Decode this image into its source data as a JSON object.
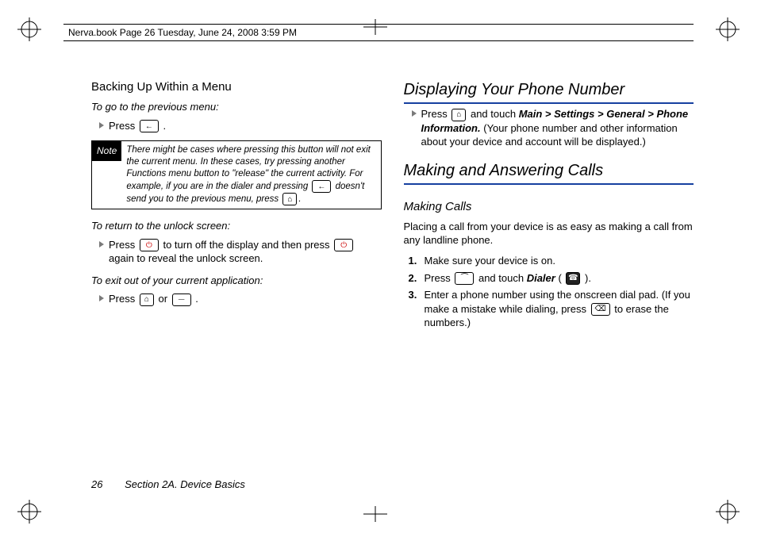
{
  "header": "Nerva.book  Page 26  Tuesday, June 24, 2008  3:59 PM",
  "left": {
    "h2": "Backing Up Within a Menu",
    "lead1": "To go to the previous menu:",
    "press": "Press ",
    "dot": ".",
    "noteLabel": "Note",
    "noteBody1": "There might be cases where pressing this button will not exit the current menu. In these cases, try pressing another Functions menu button to \"release\" the current activity. For example, if you are in the dialer and pressing ",
    "noteBody2": " doesn't send you to the previous menu, press ",
    "lead2": "To return to the unlock screen:",
    "unlock1": " to turn off the display and then press ",
    "unlock2": " again to reveal the unlock screen.",
    "lead3": "To exit out of your current application:",
    "or": " or "
  },
  "right": {
    "h1a": "Displaying Your Phone Number",
    "disp1": " and touch ",
    "dispPath": "Main > Settings > General > Phone Information.",
    "disp2": " (Your phone number and other information about your device and account will be displayed.)",
    "h1b": "Making and Answering Calls",
    "h2b": "Making Calls",
    "body": "Placing a call from your device is as easy as making a call from any landline phone.",
    "n1": "1.",
    "s1": "Make sure your device is on.",
    "n2": "2.",
    "s2a": "Press ",
    "s2b": " and touch ",
    "dialer": "Dialer",
    "s2c": " ( ",
    "s2d": " ).",
    "n3": "3.",
    "s3a": "Enter a phone number using the onscreen dial pad. (If you make a mistake while dialing, press ",
    "s3b": " to erase the numbers.)"
  },
  "footer": {
    "page": "26",
    "section": "Section 2A. Device Basics"
  }
}
